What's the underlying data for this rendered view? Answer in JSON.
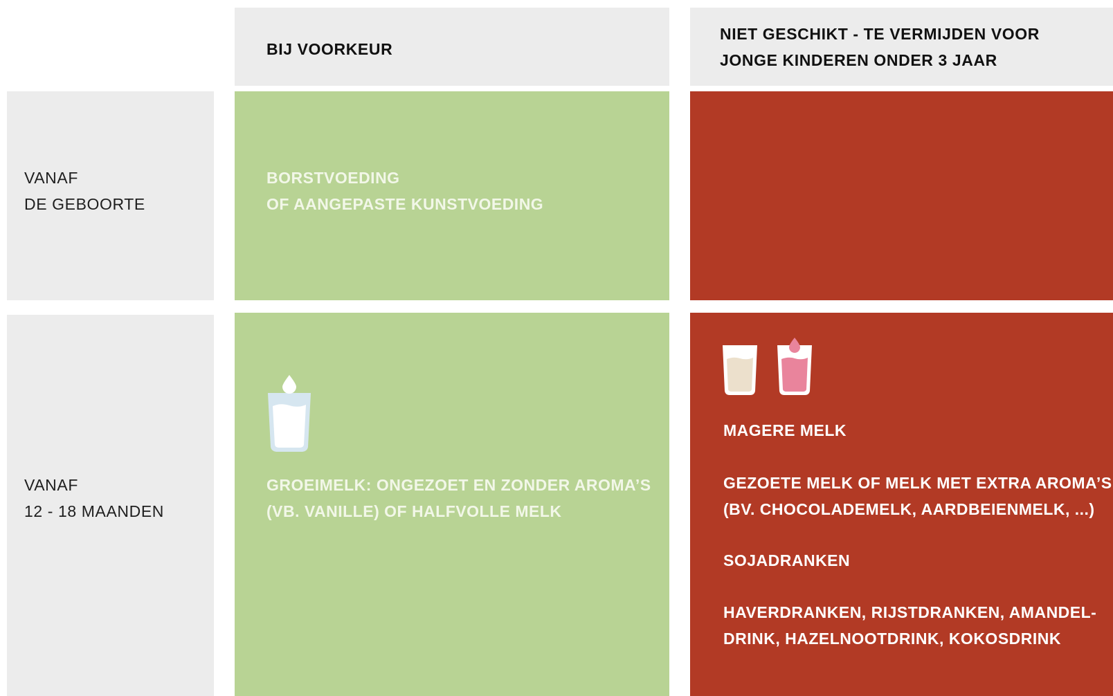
{
  "header": {
    "col_preferred": "BIJ VOORKEUR",
    "col_avoid": "NIET GESCHIKT - TE VERMIJDEN VOOR\nJONGE KINDEREN ONDER 3 JAAR"
  },
  "rows": [
    {
      "age_label": "VANAF\nDE GEBOORTE",
      "preferred": "BORSTVOEDING\nOF AANGEPASTE KUNSTVOEDING"
    },
    {
      "age_label": "VANAF\n12 - 18 MAANDEN",
      "preferred_icon": "milk-glass-icon",
      "preferred": "GROEIMELK: ONGEZOET EN ZONDER AROMA’S\n(VB. VANILLE) OF HALFVOLLE MELK",
      "avoid_icons": [
        "vanilla-milk-glass-icon",
        "strawberry-milk-glass-icon"
      ],
      "avoid_items": [
        "MAGERE MELK",
        "GEZOETE MELK OF MELK MET EXTRA AROMA’S\n(BV. CHOCOLADEMELK, AARDBEIENMELK, ...)",
        "SOJADRANKEN",
        "HAVERDRANKEN, RIJSTDRANKEN, AMANDEL-\nDRINK, HAZELNOOTDRINK, KOKOSDRINK"
      ]
    }
  ],
  "colors": {
    "header_bg": "#ececec",
    "preferred_bg": "#b8d394",
    "avoid_bg": "#b23a25",
    "milk_glass": "#d6e6f0",
    "vanilla_milk": "#ece0cc",
    "strawberry_milk": "#e9849c"
  }
}
